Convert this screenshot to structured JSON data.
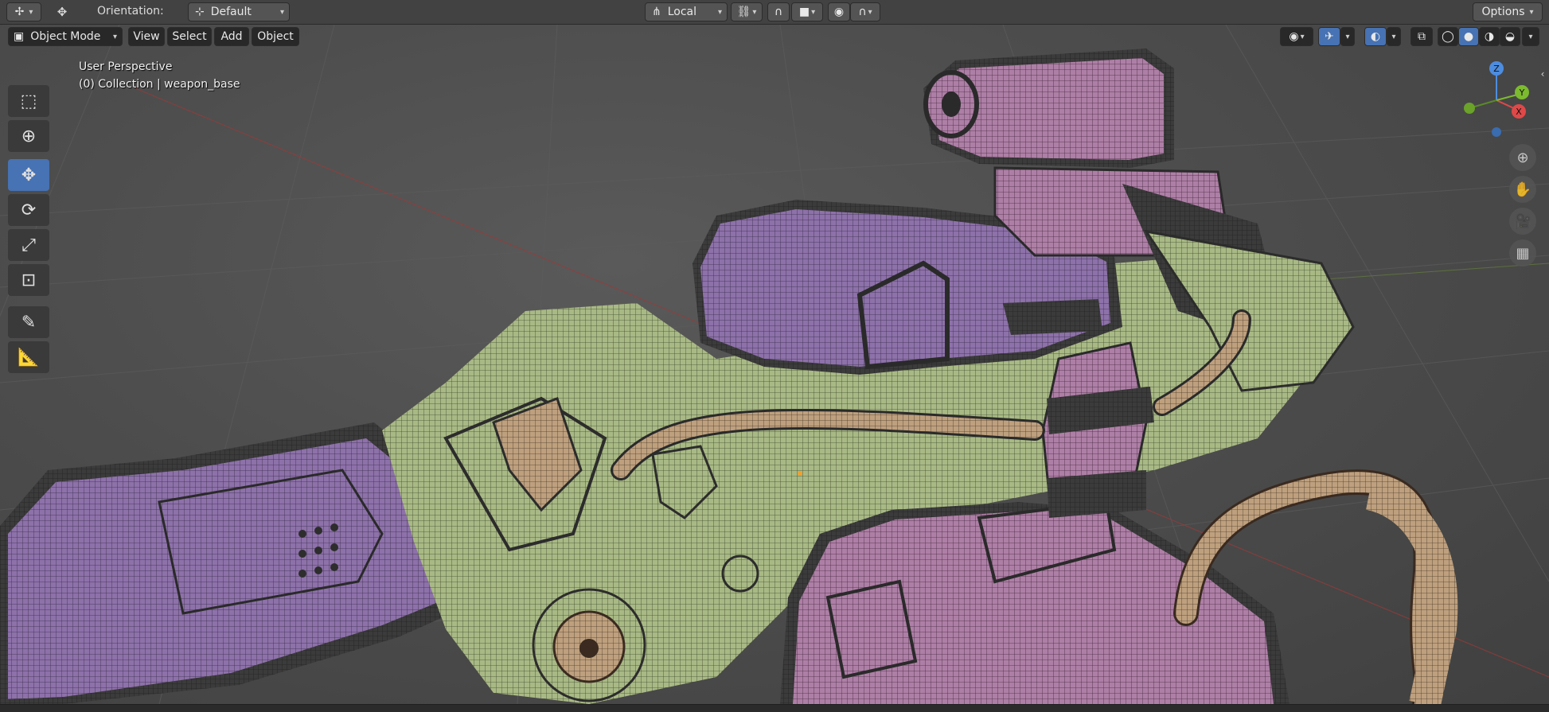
{
  "header": {
    "orientation_label": "Orientation:",
    "orientation_value": "Default",
    "pivot_value": "Local",
    "options_label": "Options"
  },
  "viewport_header": {
    "mode": "Object Mode",
    "menus": [
      "View",
      "Select",
      "Add",
      "Object"
    ]
  },
  "overlay": {
    "view_name": "User Perspective",
    "collection_info": "(0) Collection | weapon_base"
  },
  "gizmo": {
    "x": "X",
    "y": "Y",
    "z": "Z"
  },
  "icons": {
    "editor_type": "transform-gizmo-icon",
    "move": "move-icon"
  },
  "colors": {
    "accent": "#4772b3",
    "mesh_green": "#a3b47d",
    "mesh_purple": "#8c6fa8",
    "mesh_pink": "#a97ba2",
    "mesh_tan": "#b89a7a"
  }
}
